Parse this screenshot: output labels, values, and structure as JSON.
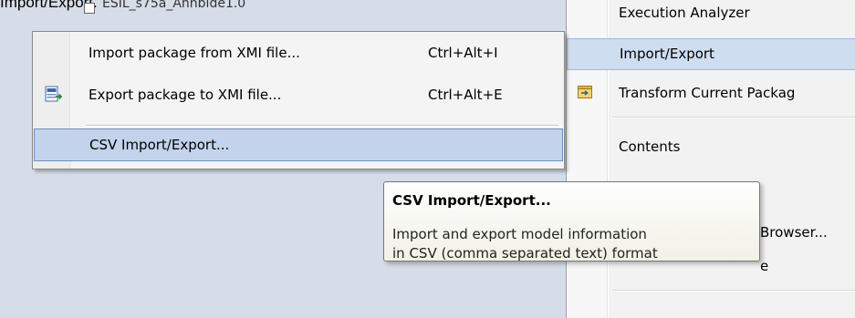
{
  "caption": "Import/Export.",
  "tree": {
    "item_label": "ESIL_s75a_Annbide1.0"
  },
  "left_menu": {
    "items": [
      {
        "label": "Import package from XMI file...",
        "shortcut": "Ctrl+Alt+I",
        "icon": "none"
      },
      {
        "label": "Export package to XMI file...",
        "shortcut": "Ctrl+Alt+E",
        "icon": "xmi-export-icon"
      },
      {
        "label": "CSV Import/Export...",
        "shortcut": "",
        "icon": "none",
        "highlighted": true
      }
    ]
  },
  "right_menu": {
    "items": [
      {
        "label": "Execution Analyzer"
      },
      {
        "label": "Import/Export",
        "highlighted": true
      },
      {
        "label": "Transform Current Packag",
        "icon": "transform-icon"
      },
      {
        "label": "Contents"
      },
      {
        "label": "Browser..."
      },
      {
        "label": "e"
      }
    ]
  },
  "tooltip": {
    "title": "CSV Import/Export...",
    "body_line1": "Import and export model information",
    "body_line2": "in CSV (comma separated text) format"
  },
  "colors": {
    "highlight_fill": "#c3d3ec",
    "highlight_border": "#6d8fc2",
    "menu_bg": "#f4f4f4",
    "tooltip_bg": "#f8f8ee"
  }
}
